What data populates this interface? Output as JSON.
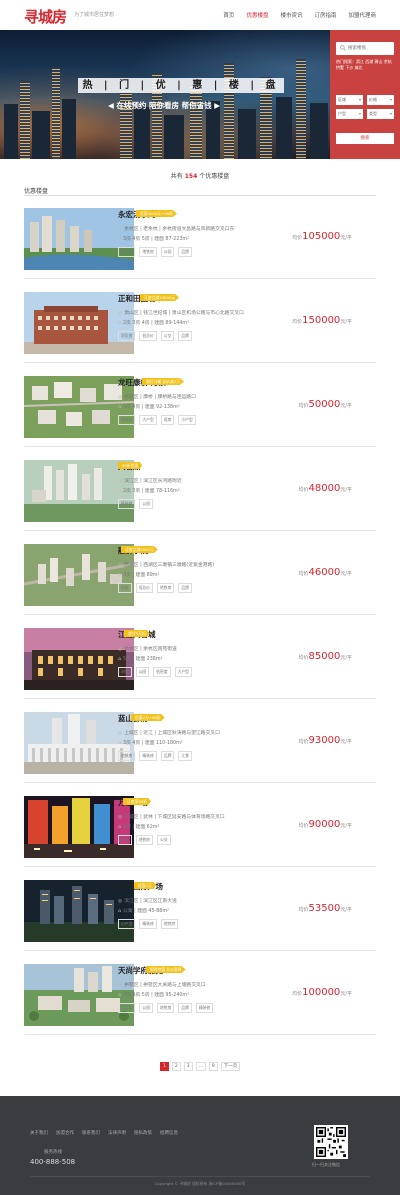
{
  "header": {
    "logo": "寻城房",
    "slogan": "为了城市居住梦想",
    "nav": [
      "首页",
      "优惠楼盘",
      "楼市资讯",
      "订房指南",
      "加盟代理商"
    ],
    "active_nav": 1
  },
  "banner": {
    "title": "热 | 门 | 优 | 惠 | 楼 | 盘",
    "subtitle": "◀ 在线预约  陪你看房  帮你省钱 ▶"
  },
  "search": {
    "placeholder": "搜索楼盘",
    "hot_tags": "热门搜索：滨江 西湖 萧山 余杭 拱墅 下沙 城北",
    "filters": [
      "区域",
      "价格",
      "户型",
      "类型"
    ],
    "button": "搜索"
  },
  "list": {
    "count_prefix": "共有",
    "count": "154",
    "count_suffix": "个优惠楼盘",
    "section_label": "优惠楼盘"
  },
  "properties": [
    {
      "name": "永宏汤水湾",
      "badge": "优惠5000元+99折",
      "address": "余杭区 | 老余杭 | 余杭街道文昌路与凤新路交叉口东",
      "info": "3房 4房 5房 | 建面 87-223m²",
      "tags": [
        "精装修",
        "地铁房",
        "公园",
        "品牌"
      ],
      "price_prefix": "均价",
      "price": "105000",
      "price_unit": "元/平"
    },
    {
      "name": "正和田园坊",
      "badge": "订房立减10000元",
      "address": "萧山区 | 钱江世纪城 | 萧山区机场公路与市心北路交叉口",
      "info": "2房 3房 4房 | 建面 89-144m²",
      "tags": [
        "学区房",
        "低总价",
        "公交",
        "品牌"
      ],
      "price_prefix": "均价",
      "price": "150000",
      "price_unit": "元/平"
    },
    {
      "name": "龙旺康桥·月景",
      "badge": "首付分期 总价减2万",
      "address": "拱墅区 | 康桥 | 康桥路与连运路口",
      "info": "3房 4房 | 建面 92-138m²",
      "tags": [
        "地铁房",
        "大户型",
        "现房",
        "小户型"
      ],
      "price_prefix": "均价",
      "price": "50000",
      "price_unit": "元/平"
    },
    {
      "name": "大名鼎",
      "badge": "99折优惠",
      "address": "滨江区 | 滨江区长河路附近",
      "info": "2房 3房 | 建面 78-116m²",
      "tags": [
        "精装修",
        "公园"
      ],
      "price_prefix": "均价",
      "price": "48000",
      "price_unit": "元/平"
    },
    {
      "name": "融侨小院",
      "badge": "订房立减5000元",
      "address": "西湖区 | 西湖区三墩镇三墩路(近紫金港路)",
      "info": "3房 | 建面 89m²",
      "tags": [
        "现房",
        "低总价",
        "地铁房",
        "品牌"
      ],
      "price_prefix": "均价",
      "price": "46000",
      "price_unit": "元/平"
    },
    {
      "name": "江山大名城",
      "badge": "首付5万起",
      "address": "余杭区 | 余杭区南苑街道",
      "info": "5房 | 建面 238m²",
      "tags": [
        "别墅",
        "公园",
        "低密度",
        "大户型"
      ],
      "price_prefix": "均价",
      "price": "85000",
      "price_unit": "元/平"
    },
    {
      "name": "蓝山御府",
      "badge": "优惠2万+98折",
      "address": "上城区 | 近江 | 上城区秋涛路与望江路交叉口",
      "info": "3房 4房 | 建面 110-180m²",
      "tags": [
        "地铁房",
        "精装修",
        "品牌",
        "江景"
      ],
      "price_prefix": "均价",
      "price": "93000",
      "price_unit": "元/平"
    },
    {
      "name": "万家广场",
      "badge": "订房享98折",
      "address": "下城区 | 武林 | 下城区延安路与体育场路交叉口",
      "info": "2房 | 建面 62m²",
      "tags": [
        "商业",
        "地铁房",
        "公交"
      ],
      "price_prefix": "均价",
      "price": "90000",
      "price_unit": "元/平"
    },
    {
      "name": "恒力国际广场",
      "badge": "优惠2万",
      "address": "滨江区 | 滨江区江南大道",
      "info": "公寓 | 建面 45-88m²",
      "tags": [
        "小户型",
        "精装修",
        "地铁房"
      ],
      "price_prefix": "均价",
      "price": "53500",
      "price_unit": "元/平"
    },
    {
      "name": "天尚学府雅苑",
      "badge": "限时特惠 总价直降",
      "address": "拱墅区 | 拱墅区大关路与上塘路交叉口",
      "info": "3房 4房 5房 | 建面 95-240m²",
      "tags": [
        "学区房",
        "公园",
        "地铁房",
        "品牌",
        "精装修"
      ],
      "price_prefix": "均价",
      "price": "100000",
      "price_unit": "元/平"
    }
  ],
  "pagination": [
    "1",
    "2",
    "3",
    "...",
    "9",
    "下一页"
  ],
  "footer": {
    "links": [
      "关于我们",
      "加盟合作",
      "联系我们",
      "法律声明",
      "隐私政策",
      "招聘信息"
    ],
    "hotline_label": "服务热线",
    "hotline": "400-888-508",
    "qr_label": "扫一扫关注微信",
    "copyright": "Copyright © 寻城房 版权所有 浙ICP备00000000号"
  },
  "colors": {
    "brand": "#d8262f",
    "badge": "#f2c21b",
    "footer": "#3a3c40",
    "search_panel": "#c9423f"
  }
}
